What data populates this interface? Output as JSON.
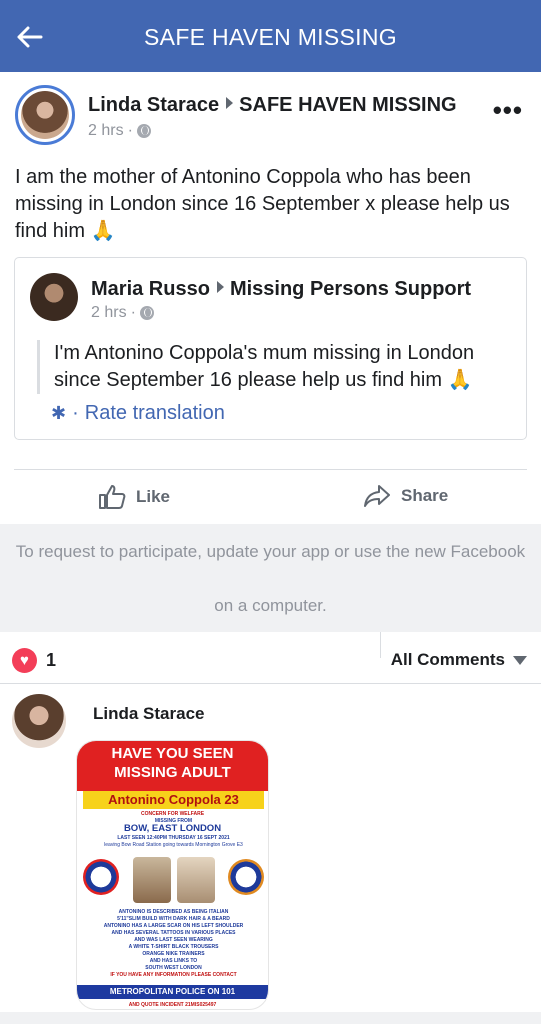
{
  "header": {
    "title": "SAFE HAVEN MISSING"
  },
  "post": {
    "author": "Linda Starace",
    "target": "SAFE HAVEN MISSING",
    "time": "2 hrs",
    "separator": "·",
    "text": "I am the mother of Antonino Coppola who has been missing in London since 16 September x please help us find him 🙏"
  },
  "shared": {
    "author": "Maria Russo",
    "target": "Missing Persons Support",
    "time": "2 hrs",
    "separator": "·",
    "text": "I'm Antonino Coppola's mum missing in London since September 16 please help us find him 🙏",
    "rate_translation": "Rate translation"
  },
  "actions": {
    "like": "Like",
    "share": "Share"
  },
  "notice": {
    "line1": "To request to participate, update your app or use the new Facebook",
    "line2": "on a computer."
  },
  "reactions": {
    "count": "1",
    "all_comments": "All Comments"
  },
  "comment": {
    "author": "Linda Starace"
  },
  "poster": {
    "line1": "HAVE YOU SEEN",
    "line2": "MISSING ADULT",
    "name": "Antonino Coppola 23",
    "concern": "CONCERN FOR WELFARE",
    "missing_from": "MISSING FROM",
    "location": "BOW, EAST LONDON",
    "last_seen": "LAST SEEN 12:40PM THURSDAY 16 SEPT 2021",
    "leaving": "leaving Bow Road Station going towards Mornington Grove E3",
    "desc1": "ANTONINO IS DESCRIBED AS BEING ITALIAN",
    "desc2": "5'11\"SLIM BUILD WITH DARK HAIR & A BEARD",
    "desc3": "ANTONINO HAS A LARGE SCAR ON HIS LEFT SHOULDER",
    "desc4": "AND HAS SEVERAL TATTOOS IN VARIOUS PLACES",
    "desc5": "AND WAS LAST SEEN WEARING",
    "desc6": "A WHITE T-SHIRT BLACK TROUSERS",
    "desc7": "ORANGE NIKE TRAINERS",
    "desc8": "AND HAS LINKS TO",
    "desc9": "SOUTH WEST LONDON",
    "desc10": "IF YOU HAVE ANY INFORMATION PLEASE CONTACT",
    "police": "METROPOLITAN POLICE ON 101",
    "quote": "AND QUOTE INCIDENT 21MIS025497"
  },
  "colors": {
    "header_bg": "#4267b2",
    "link": "#4267b2",
    "heart": "#f33e58",
    "notice_bg": "#f0f1f3"
  }
}
